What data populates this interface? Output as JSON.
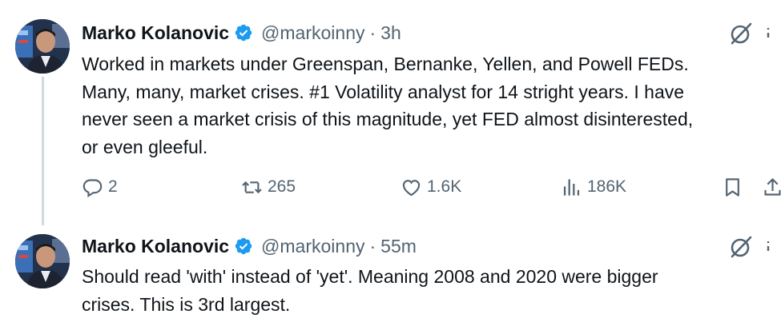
{
  "colors": {
    "primary_text": "#0f1419",
    "secondary_text": "#536471",
    "verified_blue": "#1d9bf0",
    "thread_line": "#cfd9de",
    "background": "#ffffff"
  },
  "tweets": [
    {
      "author_name": "Marko Kolanovic",
      "verified": true,
      "handle": "@markoinny",
      "separator": "·",
      "time": "3h",
      "text": "Worked in markets under Greenspan, Bernanke, Yellen, and Powell FEDs.\nMany, many, market crises. #1 Volatility analyst for 14 stright years. I have\nnever seen a market crisis of this magnitude, yet FED almost disinterested,\nor even gleeful.",
      "actions": {
        "reply_count": "2",
        "retweet_count": "265",
        "like_count": "1.6K",
        "view_count": "186K"
      },
      "icons": [
        "reply-icon",
        "retweet-icon",
        "like-icon",
        "views-icon",
        "bookmark-icon",
        "share-icon",
        "grok-icon",
        "more-icon"
      ]
    },
    {
      "author_name": "Marko Kolanovic",
      "verified": true,
      "handle": "@markoinny",
      "separator": "·",
      "time": "55m",
      "text": "Should read 'with' instead of 'yet'. Meaning 2008 and 2020 were bigger\ncrises. This is 3rd largest.",
      "icons": [
        "grok-icon",
        "more-icon"
      ]
    }
  ]
}
